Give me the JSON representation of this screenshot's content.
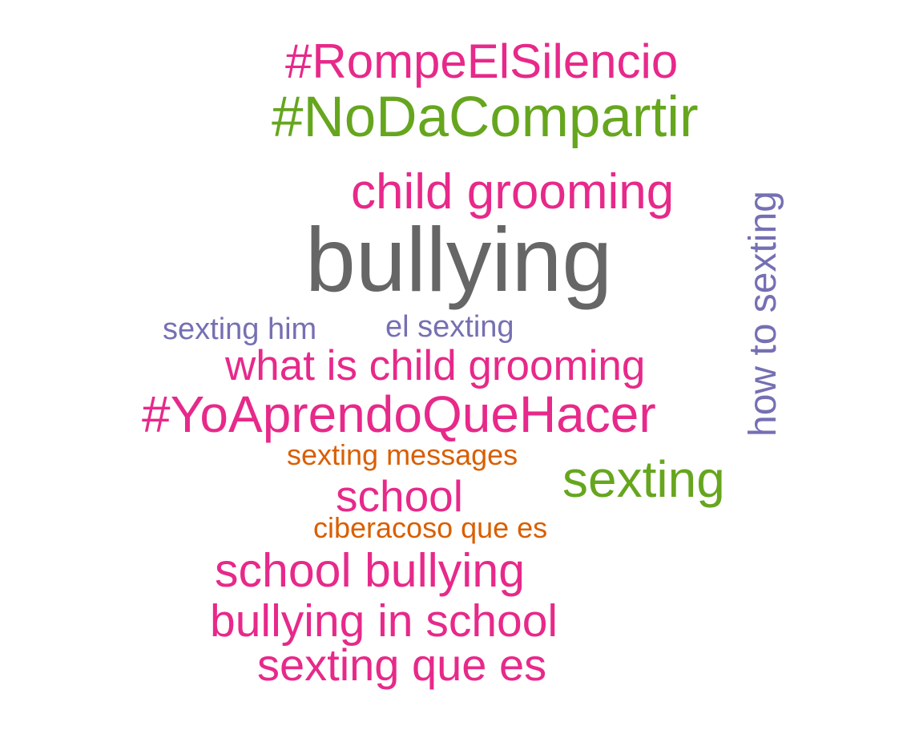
{
  "words": [
    {
      "key": "rompe",
      "text": "#RompeElSilencio",
      "color": "#e7298a"
    },
    {
      "key": "noda",
      "text": "#NoDaCompartir",
      "color": "#66a61e"
    },
    {
      "key": "childg",
      "text": "child grooming",
      "color": "#e7298a"
    },
    {
      "key": "bullying",
      "text": "bullying",
      "color": "#666666"
    },
    {
      "key": "sexhim",
      "text": "sexting him",
      "color": "#7570b3"
    },
    {
      "key": "elsex",
      "text": "el sexting",
      "color": "#7570b3"
    },
    {
      "key": "whatis",
      "text": "what is child grooming",
      "color": "#e7298a"
    },
    {
      "key": "yoap",
      "text": "#YoAprendoQueHacer",
      "color": "#e7298a"
    },
    {
      "key": "howto",
      "text": "how to sexting",
      "color": "#7570b3",
      "orientation": "vertical"
    },
    {
      "key": "sexmsg",
      "text": "sexting messages",
      "color": "#d95f02"
    },
    {
      "key": "sexting",
      "text": "sexting",
      "color": "#66a61e"
    },
    {
      "key": "school",
      "text": "school",
      "color": "#e7298a"
    },
    {
      "key": "ciber",
      "text": "ciberacoso que es",
      "color": "#d95f02"
    },
    {
      "key": "schoolb",
      "text": "school bullying",
      "color": "#e7298a"
    },
    {
      "key": "bullyin",
      "text": "bullying in school",
      "color": "#e7298a"
    },
    {
      "key": "sexque",
      "text": "sexting que es",
      "color": "#e7298a"
    }
  ]
}
